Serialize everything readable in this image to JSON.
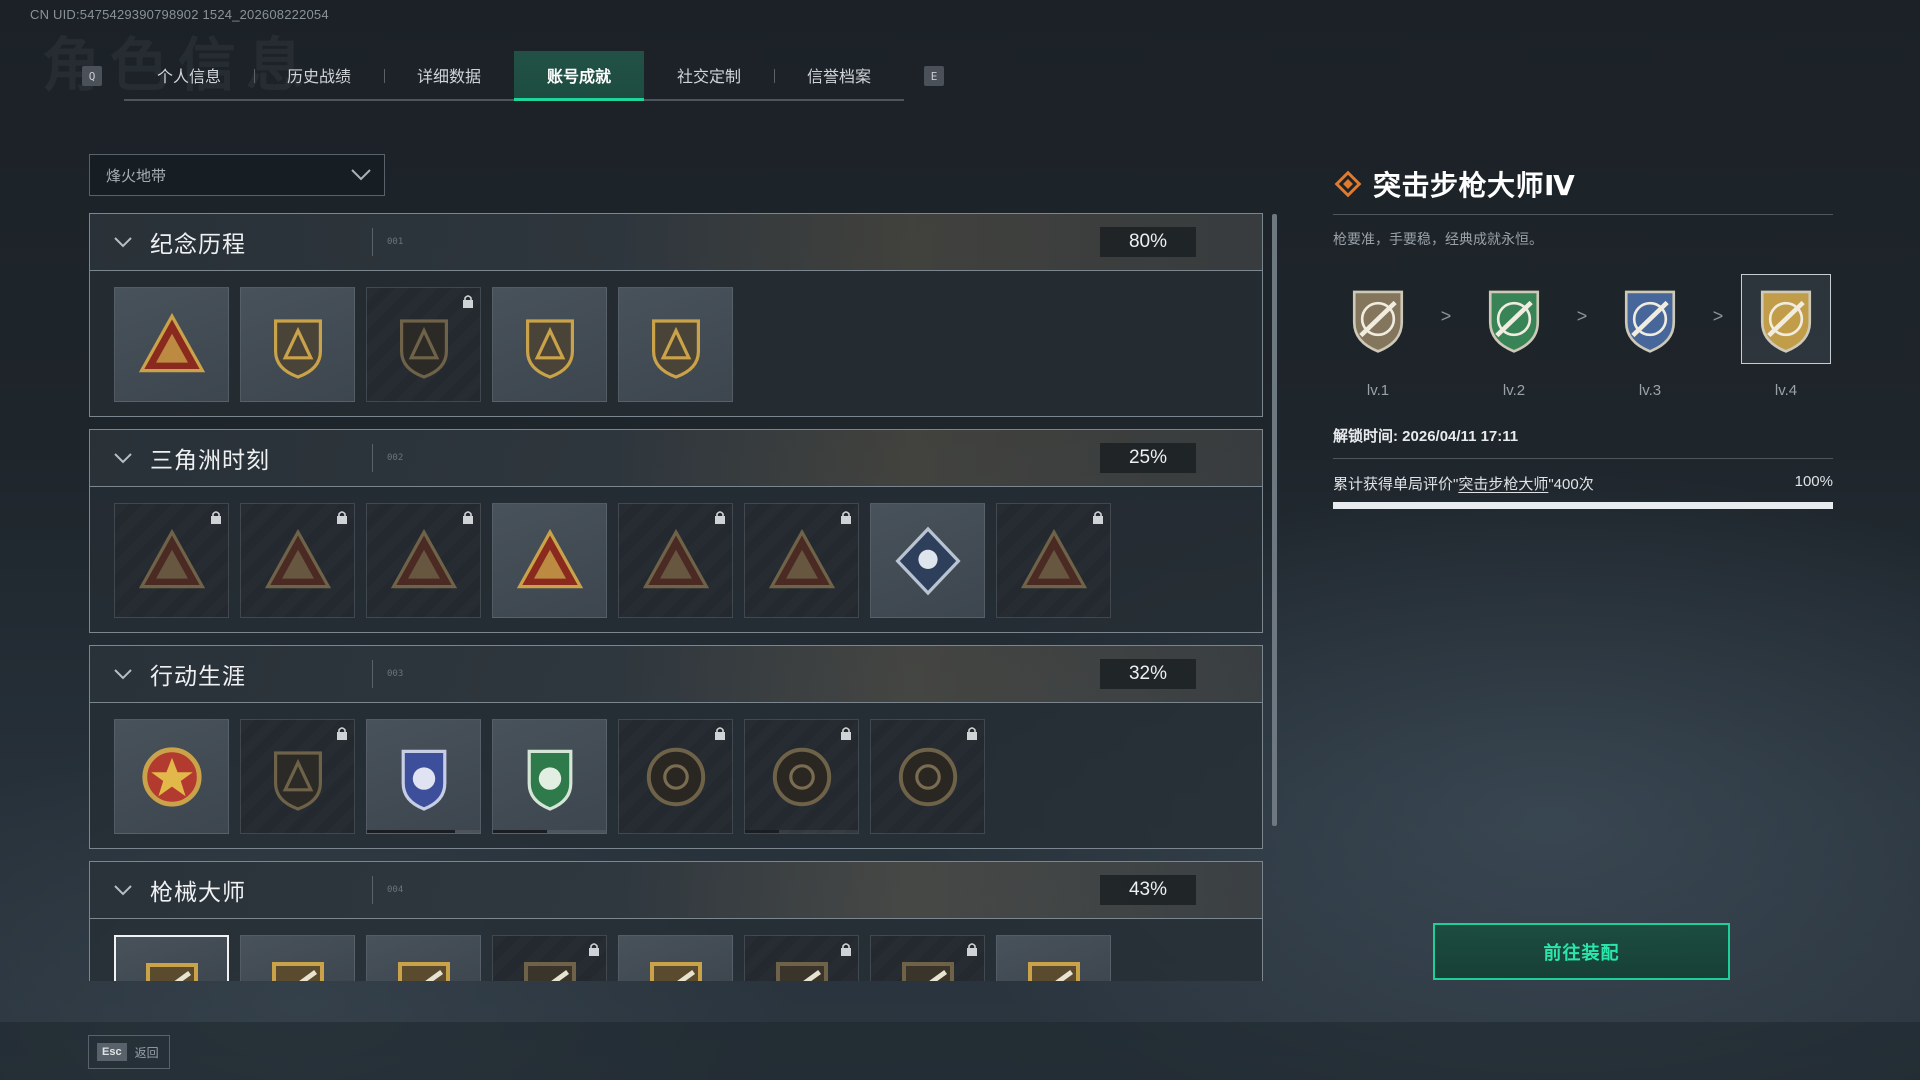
{
  "uid": "CN UID:5475429390798902 1524_202608222054",
  "ghost_title": "角色信息",
  "tabs": {
    "prev_key": "Q",
    "next_key": "E",
    "items": [
      {
        "label": "个人信息"
      },
      {
        "label": "历史战绩"
      },
      {
        "label": "详细数据"
      },
      {
        "label": "账号成就",
        "active": true
      },
      {
        "label": "社交定制"
      },
      {
        "label": "信誉档案"
      }
    ]
  },
  "mode_select": {
    "value": "烽火地带"
  },
  "sections": [
    {
      "name": "纪念历程",
      "code": "001",
      "percent": "80%",
      "tiles": [
        {
          "icon": "tri-mountain-badge",
          "locked": false
        },
        {
          "icon": "helicopter-badge",
          "locked": false
        },
        {
          "icon": "dark-emblem-badge",
          "locked": true
        },
        {
          "icon": "gold-wave-badge",
          "locked": false
        },
        {
          "icon": "number-one-badge",
          "locked": false
        }
      ]
    },
    {
      "name": "三角洲时刻",
      "code": "002",
      "percent": "25%",
      "tiles": [
        {
          "icon": "bottle-tri-badge",
          "locked": true
        },
        {
          "icon": "figure-tri-badge",
          "locked": true
        },
        {
          "icon": "wolf-tri-badge",
          "locked": true
        },
        {
          "icon": "soldiers-tri-badge",
          "locked": false
        },
        {
          "icon": "squad-tri-badge",
          "locked": true
        },
        {
          "icon": "fish-tri-badge",
          "locked": true
        },
        {
          "icon": "rose-diamond-badge",
          "locked": false
        },
        {
          "icon": "swirl-tri-badge",
          "locked": true
        }
      ]
    },
    {
      "name": "行动生涯",
      "code": "003",
      "percent": "32%",
      "tiles": [
        {
          "icon": "star-medal-badge",
          "locked": false
        },
        {
          "icon": "shield-dark-badge",
          "locked": true
        },
        {
          "icon": "blue-shield-badge",
          "locked": false,
          "progress": 0.78
        },
        {
          "icon": "green-shield-badge",
          "locked": false,
          "progress": 0.48
        },
        {
          "icon": "dark-coin-badge",
          "locked": true
        },
        {
          "icon": "skull-coin-badge",
          "locked": true,
          "progress": 0.3
        },
        {
          "icon": "eye-coin-badge",
          "locked": true
        }
      ]
    },
    {
      "name": "枪械大师",
      "code": "004",
      "percent": "43%",
      "tiles": [
        {
          "icon": "rifle-master-badge",
          "locked": false,
          "selected": true
        },
        {
          "icon": "rifle-master-badge",
          "locked": false
        },
        {
          "icon": "rifle-master-badge",
          "locked": false
        },
        {
          "icon": "rifle-master-badge",
          "locked": true
        },
        {
          "icon": "rifle-master-badge",
          "locked": false
        },
        {
          "icon": "rifle-master-badge",
          "locked": true
        },
        {
          "icon": "rifle-master-badge",
          "locked": true
        },
        {
          "icon": "rifle-master-badge",
          "locked": false
        }
      ]
    }
  ],
  "detail": {
    "title": "突击步枪大师Ⅳ",
    "description": "枪要准，手要稳，经典成就永恒。",
    "levels": [
      {
        "label": "lv.1",
        "color": "#8a7a60"
      },
      {
        "label": "lv.2",
        "color": "#3a8a5a"
      },
      {
        "label": "lv.3",
        "color": "#4a6aa0"
      },
      {
        "label": "lv.4",
        "color": "#c9a24a",
        "current": true
      }
    ],
    "arrow": ">",
    "unlock_time": "解锁时间: 2026/04/11 17:11",
    "condition_prefix": "累计获得单局评价\"",
    "condition_link": "突击步枪大师",
    "condition_suffix": "\"400次",
    "progress_text": "100%",
    "progress": 1.0
  },
  "equip_button": "前往装配",
  "footer": {
    "key": "Esc",
    "label": "返回"
  },
  "colors": {
    "accent": "#1fcf98",
    "orange": "#e07a2e",
    "gold": "#c9a24a"
  }
}
